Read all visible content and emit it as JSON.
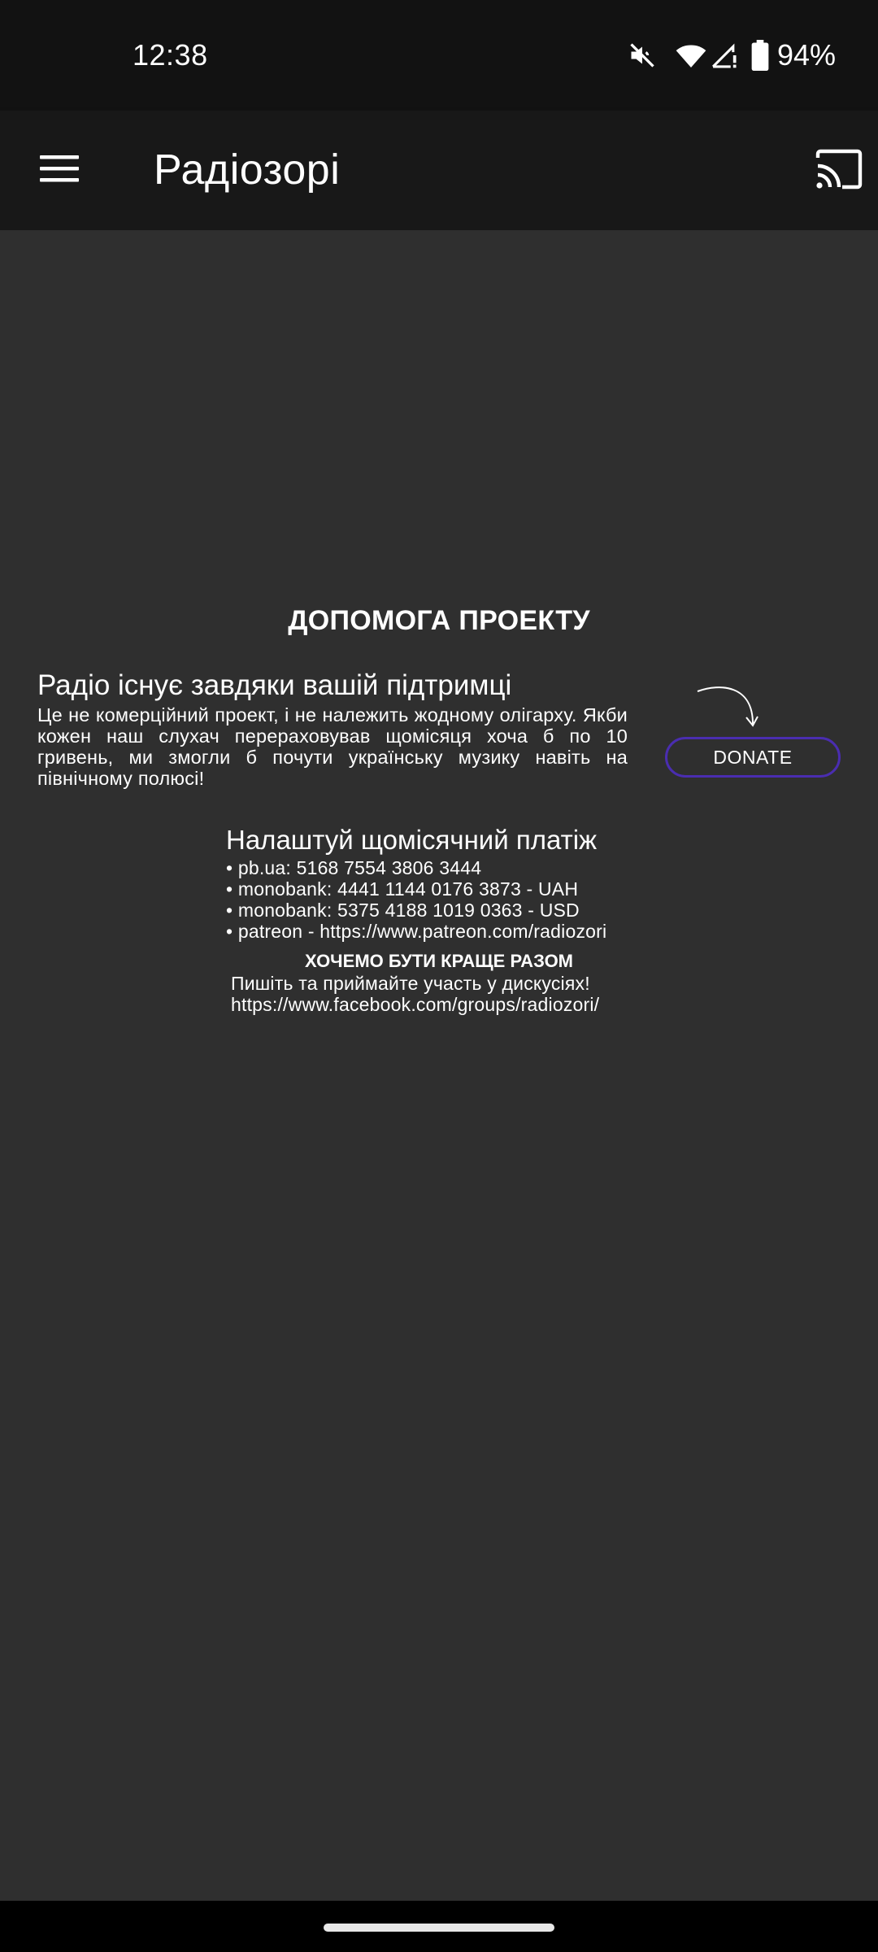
{
  "status_bar": {
    "time": "12:38",
    "battery_percent": "94%",
    "icons": [
      "mute-icon",
      "wifi-icon",
      "signal-icon",
      "battery-icon"
    ]
  },
  "app_bar": {
    "title": "Радіозорі",
    "menu_icon": "hamburger-menu-icon",
    "cast_icon": "cast-icon"
  },
  "support": {
    "heading": "ДОПОМОГА ПРОЕКТУ",
    "title": "Радіо існує завдяки вашій підтримці",
    "text": "Це не комерційний проект, і не належить жодному олігарху. Якби кожен наш слухач перераховував щомісяця хоча б по 10 гривень, ми змогли б почути українську музику навіть на північному полюсі!",
    "donate_label": "DONATE"
  },
  "monthly": {
    "title": "Налаштуй щомісячний платіж",
    "items": [
      "pb.ua: 5168 7554 3806 3444",
      "monobank: 4441 1144 0176 3873 - UAH",
      "monobank: 5375 4188 1019 0363 - USD",
      "patreon - https://www.patreon.com/radiozori"
    ]
  },
  "together": {
    "title": "ХОЧЕМО БУТИ КРАЩЕ РАЗОМ",
    "text": "Пишіть та приймайте участь у дискусіях!",
    "link": "https://www.facebook.com/groups/radiozori/"
  },
  "colors": {
    "background": "#2f2f2f",
    "app_bar": "#181818",
    "status_bar": "#121212",
    "donate_border": "#4a2db0"
  }
}
